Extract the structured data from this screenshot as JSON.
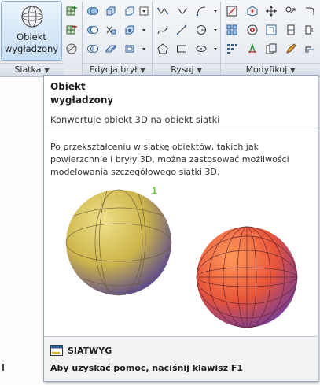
{
  "ribbon": {
    "smooth_button": {
      "label": "Obiekt\nwygładzony"
    },
    "panels": [
      {
        "label": "Siatka",
        "has_dropdown": true
      },
      {
        "label": "Edycja brył",
        "has_dropdown": true
      },
      {
        "label": "Rysuj",
        "has_dropdown": true
      },
      {
        "label": "Modyfikuj",
        "has_dropdown": true
      }
    ]
  },
  "tooltip": {
    "title": "Obiekt\nwygładzony",
    "subtitle": "Konwertuje obiekt 3D na obiekt siatki",
    "body": "Po przekształceniu w siatkę obiektów, takich jak powierzchnie i bryły 3D, można zastosować możliwości modelowania szczegółowego siatki 3D.",
    "illustration_label": "1",
    "command": "SIATWYG",
    "help": "Aby uzyskać pomoc, naciśnij klawisz F1"
  },
  "colors": {
    "smooth_sphere": "#d6c457",
    "mesh_sphere": "#e8553a",
    "label_green": "#6fbf3a",
    "selected_button": "#c9def4"
  }
}
